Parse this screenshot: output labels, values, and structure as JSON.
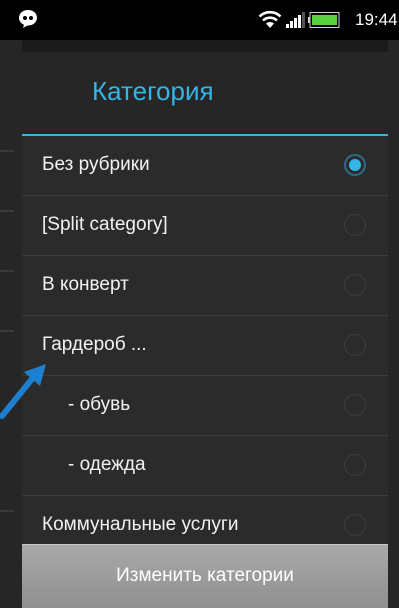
{
  "status_bar": {
    "time": "19:44",
    "app_icon": "chat-bubble-icon",
    "wifi_icon": "wifi-icon",
    "signal_icon": "signal-icon",
    "battery_icon": "battery-icon",
    "battery_color": "#5bd043"
  },
  "dialog": {
    "title": "Категория",
    "accent_color": "#33b5e5",
    "items": [
      {
        "label": "Без рубрики",
        "selected": true
      },
      {
        "label": "[Split category]",
        "selected": false
      },
      {
        "label": "В конверт",
        "selected": false
      },
      {
        "label": "Гардероб ...",
        "selected": false
      },
      {
        "label": "- обувь",
        "selected": false
      },
      {
        "label": "- одежда",
        "selected": false
      },
      {
        "label": "Коммунальные услуги",
        "selected": false
      }
    ],
    "button_label": "Изменить категории"
  },
  "annotation": {
    "arrow_icon": "arrow-icon",
    "color": "#1e7fd0"
  }
}
